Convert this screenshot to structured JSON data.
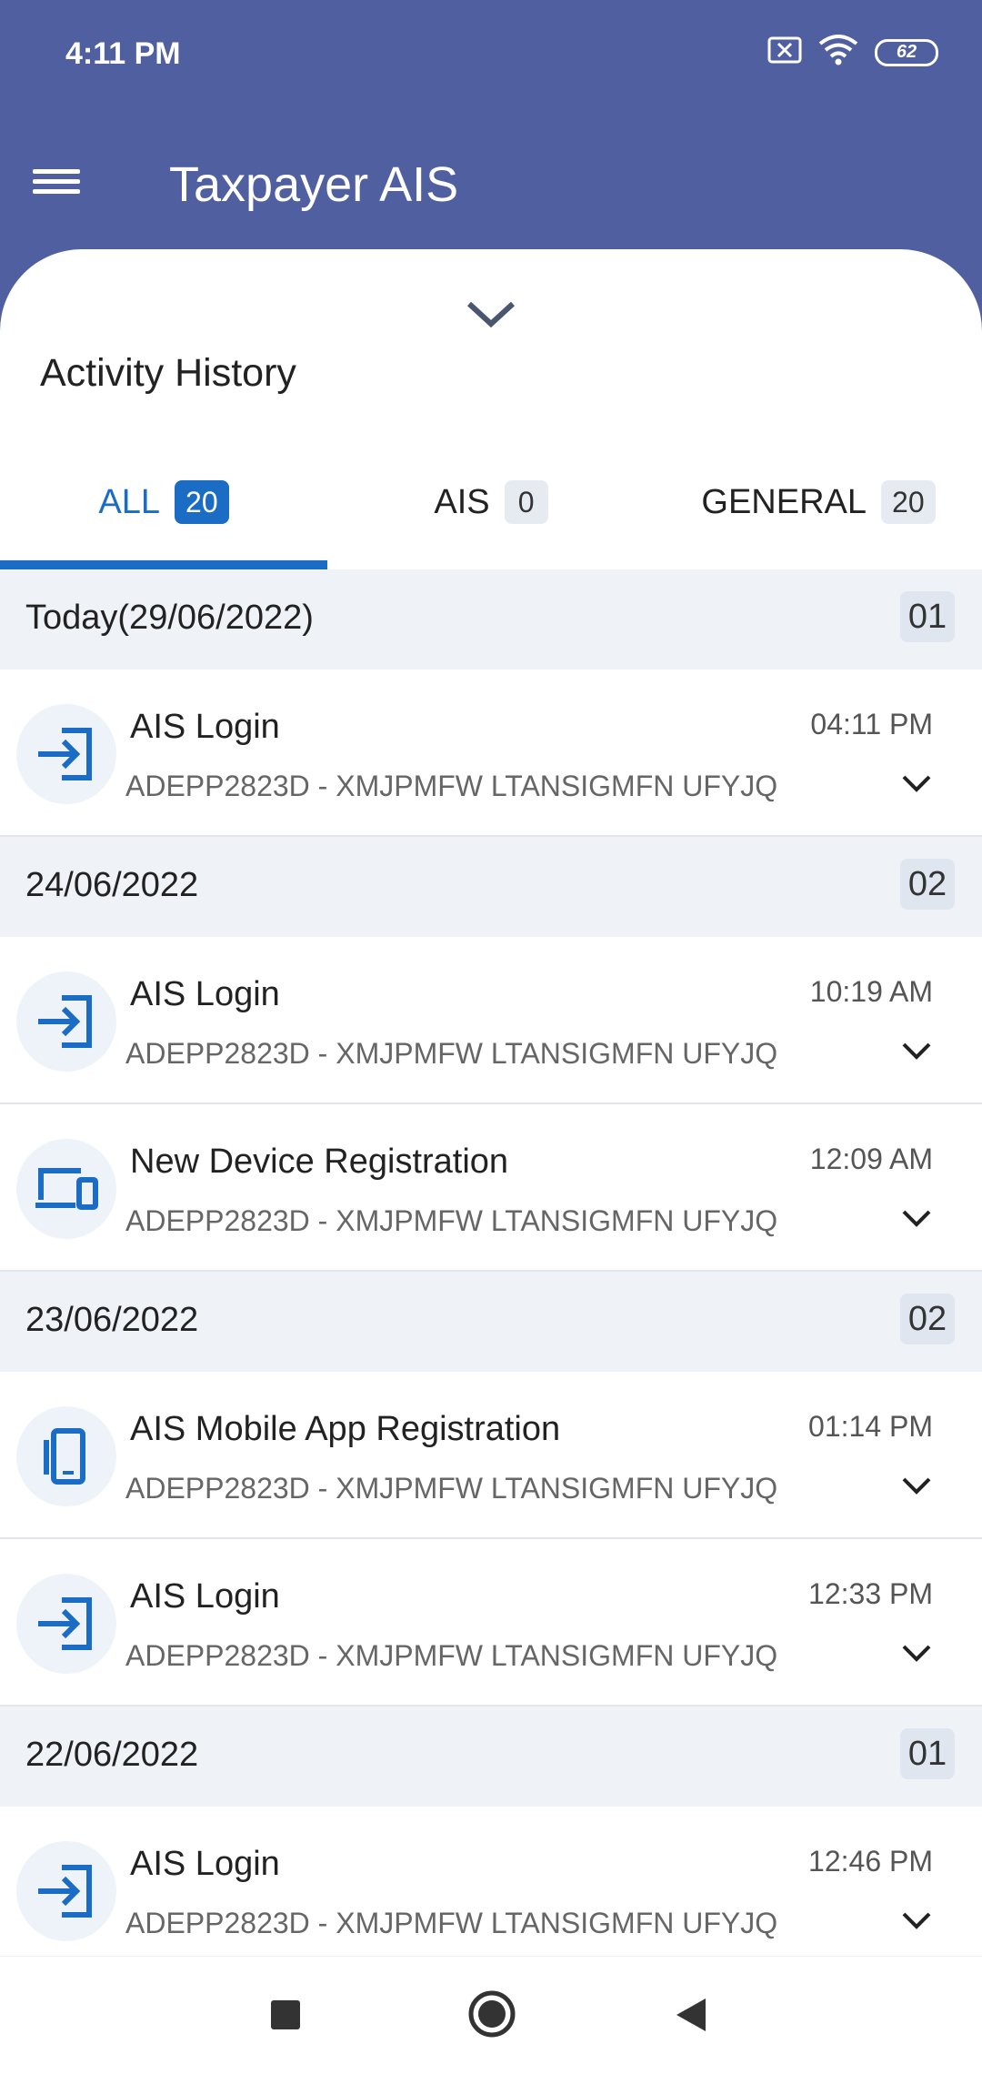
{
  "status_bar": {
    "time": "4:11 PM",
    "battery": "62"
  },
  "header": {
    "title": "Taxpayer AIS"
  },
  "sheet": {
    "title": "Activity History"
  },
  "tabs": [
    {
      "label": "ALL",
      "count": "20",
      "active": true
    },
    {
      "label": "AIS",
      "count": "0",
      "active": false
    },
    {
      "label": "GENERAL",
      "count": "20",
      "active": false
    }
  ],
  "groups": [
    {
      "date": "Today(29/06/2022)",
      "count": "01",
      "items": [
        {
          "icon": "login-icon",
          "title": "AIS Login",
          "subtitle": "ADEPP2823D - XMJPMFW LTANSIGMFN UFYJQ",
          "time": "04:11 PM"
        }
      ]
    },
    {
      "date": "24/06/2022",
      "count": "02",
      "items": [
        {
          "icon": "login-icon",
          "title": "AIS Login",
          "subtitle": "ADEPP2823D - XMJPMFW LTANSIGMFN UFYJQ",
          "time": "10:19 AM"
        },
        {
          "icon": "devices-icon",
          "title": "New Device Registration",
          "subtitle": "ADEPP2823D - XMJPMFW LTANSIGMFN UFYJQ",
          "time": "12:09 AM"
        }
      ]
    },
    {
      "date": "23/06/2022",
      "count": "02",
      "items": [
        {
          "icon": "mobile-icon",
          "title": "AIS Mobile App Registration",
          "subtitle": "ADEPP2823D - XMJPMFW LTANSIGMFN UFYJQ",
          "time": "01:14 PM"
        },
        {
          "icon": "login-icon",
          "title": "AIS Login",
          "subtitle": "ADEPP2823D - XMJPMFW LTANSIGMFN UFYJQ",
          "time": "12:33 PM"
        }
      ]
    },
    {
      "date": "22/06/2022",
      "count": "01",
      "items": [
        {
          "icon": "login-icon",
          "title": "AIS Login",
          "subtitle": "ADEPP2823D - XMJPMFW LTANSIGMFN UFYJQ",
          "time": "12:46 PM"
        }
      ]
    }
  ],
  "colors": {
    "header": "#4f5fa0",
    "accent": "#1a6cc4",
    "group_bg": "#eff2f7"
  }
}
